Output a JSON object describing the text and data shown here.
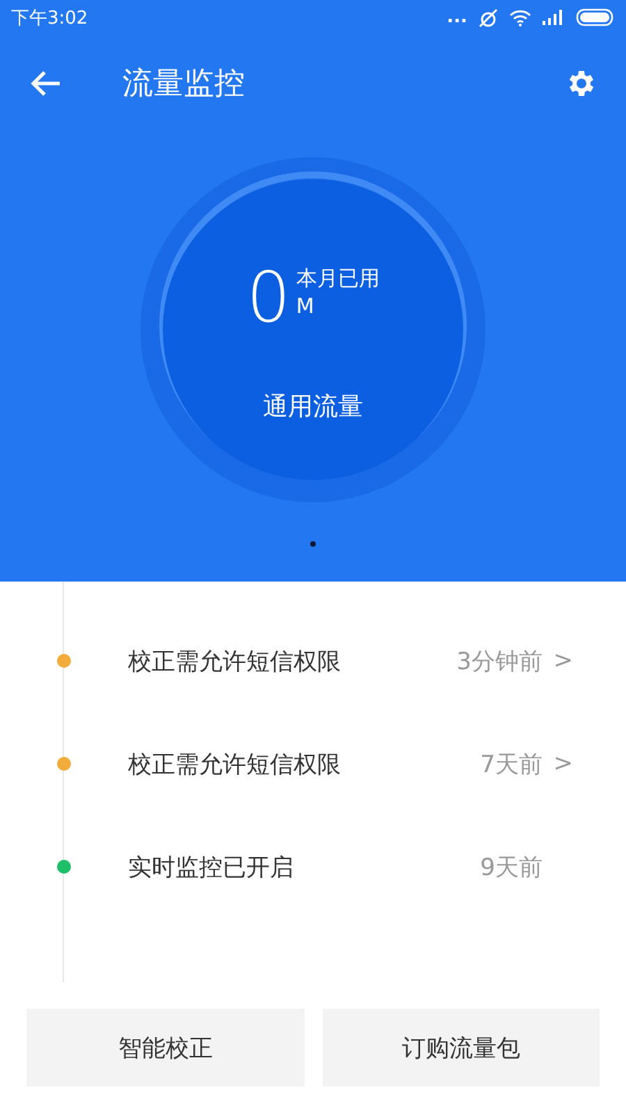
{
  "status_bar": {
    "time": "下午3:02",
    "more": "..."
  },
  "header": {
    "title": "流量监控"
  },
  "gauge": {
    "amount": "0",
    "unit": "M",
    "caption": "本月已用",
    "label": "通用流量"
  },
  "pager": [
    {
      "selected": true
    }
  ],
  "events": [
    {
      "text": "校正需允许短信权限",
      "time": "3分钟前",
      "arrow": ">",
      "color": "#f2ac3c"
    },
    {
      "text": "校正需允许短信权限",
      "time": "7天前",
      "arrow": ">",
      "color": "#f2ac3c"
    },
    {
      "text": "实时监控已开启",
      "time": "9天前",
      "color": "#1fbf6a"
    }
  ],
  "buttons": [
    "智能校正",
    "订购流量包"
  ]
}
